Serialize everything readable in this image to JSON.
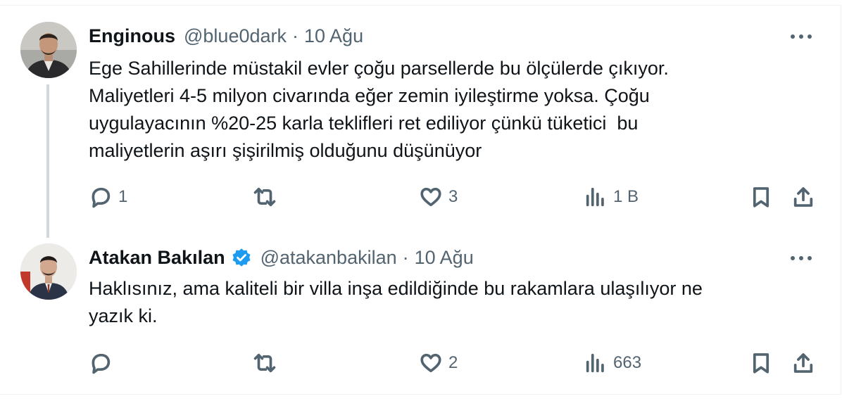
{
  "tweets": [
    {
      "name": "Enginous",
      "handle": "@blue0dark",
      "separator": "·",
      "date": "10 Ağu",
      "verified": false,
      "text_lines": [
        "Ege Sahillerinde müstakil evler çoğu parsellerde bu ölçülerde çıkıyor.",
        "Maliyetleri 4-5 milyon civarında eğer zemin iyileştirme yoksa. Çoğu",
        "uygulayacının %20-25 karla teklifleri ret ediliyor çünkü tüketici  bu",
        "maliyetlerin aşırı şişirilmiş olduğunu düşünüyor"
      ],
      "replies": "1",
      "retweets": "",
      "likes": "3",
      "views": "1 B",
      "avatar_icon": "user-avatar-enginous"
    },
    {
      "name": "Atakan Bakılan",
      "handle": "@atakanbakilan",
      "separator": "·",
      "date": "10 Ağu",
      "verified": true,
      "text_lines": [
        "Haklısınız, ama kaliteli bir villa inşa edildiğinde bu rakamlara ulaşılıyor ne",
        "yazık ki."
      ],
      "replies": "",
      "retweets": "",
      "likes": "2",
      "views": "663",
      "avatar_icon": "user-avatar-atakan"
    }
  ],
  "colors": {
    "text": "#0f1419",
    "secondary": "#536471",
    "verified": "#1d9bf0",
    "thread_line": "#cfd9de",
    "border": "#eff3f4"
  }
}
